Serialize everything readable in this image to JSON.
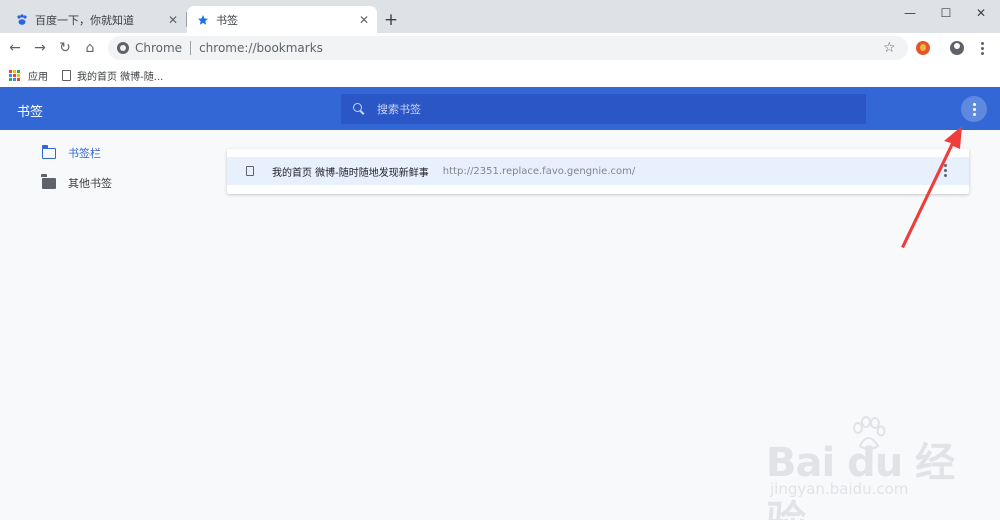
{
  "browser": {
    "tabs": [
      {
        "label": "百度一下，你就知道",
        "close": "✕",
        "active": false
      },
      {
        "label": "书签",
        "close": "✕",
        "active": true
      }
    ],
    "new_tab": "+",
    "window_controls": {
      "minimize": "—",
      "maximize": "☐",
      "close": "✕"
    }
  },
  "toolbar": {
    "back": "←",
    "forward": "→",
    "reload": "↻",
    "home": "⌂",
    "omnibox": {
      "chip": "Chrome",
      "url": "chrome://bookmarks"
    },
    "star": "☆"
  },
  "bookmarks_bar": {
    "apps_label": "应用",
    "item_label": "我的首页 微博-随...",
    "apps_colors": [
      "#ea4335",
      "#fbbc05",
      "#34a853",
      "#4285f4",
      "#ea4335",
      "#fbbc05",
      "#34a853",
      "#4285f4",
      "#ea4335"
    ]
  },
  "app": {
    "title": "书签",
    "search_placeholder": "搜索书签",
    "accent": "#3367d6"
  },
  "sidebar": {
    "items": [
      {
        "label": "书签栏",
        "selected": true
      },
      {
        "label": "其他书签",
        "selected": false
      }
    ]
  },
  "list": {
    "items": [
      {
        "title": "我的首页 微博-随时随地发现新鲜事",
        "url": "http://2351.replace.favo.gengnie.com/"
      }
    ]
  },
  "annotation": {
    "arrow_color": "#f03c3c"
  },
  "watermark": {
    "brand_mark": "Bai du 经验",
    "site": "jingyan.baidu.com"
  }
}
